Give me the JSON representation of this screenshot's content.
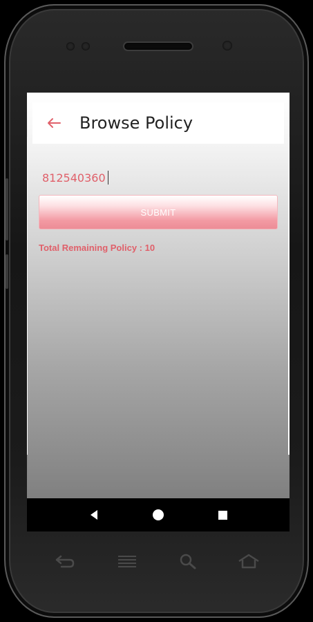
{
  "app_bar": {
    "title": "Browse Policy",
    "back_icon": "arrow-left-icon"
  },
  "form": {
    "input_value": "812540360",
    "submit_label": "SUBMIT",
    "remaining_text": "Total Remaining Policy : 10"
  },
  "nav_bar": {
    "icons": [
      "back-triangle-icon",
      "home-circle-icon",
      "recents-square-icon"
    ]
  },
  "hardware_keys": {
    "icons": [
      "return-arrow-icon",
      "menu-lines-icon",
      "search-icon",
      "home-house-icon"
    ]
  },
  "colors": {
    "accent": "#e0606a",
    "button_gradient_end": "#ec8c96",
    "app_bar_bg": "#ffffff"
  }
}
